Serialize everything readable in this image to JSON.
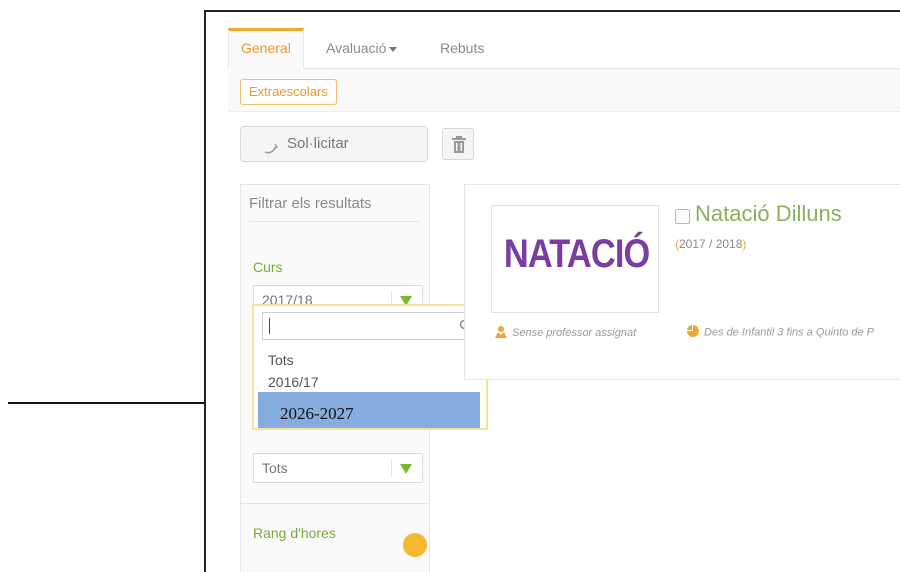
{
  "tabs": [
    {
      "label": "General",
      "active": true
    },
    {
      "label": "Avaluació",
      "has_caret": true
    },
    {
      "label": "Rebuts"
    }
  ],
  "subtab": {
    "label": "Extraescolars"
  },
  "toolbar": {
    "solicitar_label": "Sol·licitar",
    "icons": [
      "refresh-icon",
      "trash-icon"
    ]
  },
  "filter": {
    "title": "Filtrar els resultats",
    "curs_label": "Curs",
    "curs_value": "2017/18",
    "second_value": "Tots",
    "rang_label": "Rang d'hores"
  },
  "dropdown": {
    "search_value": "",
    "options": [
      "Tots",
      "2016/17"
    ],
    "highlighted": "2026-2027"
  },
  "card": {
    "image_text": "NATACIÓ",
    "title": "Natació Dilluns",
    "year": "2017 / 2018",
    "year_open": "(",
    "year_close": ")",
    "teacher": "Sense professor assignat",
    "range": "Des de Infantil 3 fins a Quinto de P"
  },
  "colors": {
    "accent": "#f0a830",
    "green": "#7aa83c",
    "highlight": "#86acdf",
    "title_purple": "#7b3da0"
  }
}
